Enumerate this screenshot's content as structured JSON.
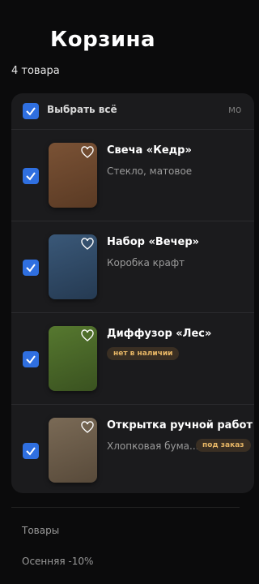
{
  "page": {
    "title": "Корзина",
    "count": "4 товара"
  },
  "select_all": {
    "label": "Выбрать всё",
    "more": "мо"
  },
  "items": [
    {
      "name": "Свеча «Кедр»",
      "subtitle": "Стекло, матовое",
      "badge": "",
      "color": "#6f4a2f"
    },
    {
      "name": "Набор «Вечер»",
      "subtitle": "Коробка крафт",
      "badge": "",
      "color": "#2f4a66"
    },
    {
      "name": "Диффузор «Лес»",
      "subtitle": "",
      "badge": "нет в наличии",
      "color": "#4a6a2c"
    },
    {
      "name": "Открытка ручной работ",
      "subtitle": "Хлопковая бума...",
      "badge": "под заказ",
      "color": "#6e6050"
    }
  ],
  "summary": {
    "goods": "Товары",
    "discount": "Осенняя -10%"
  },
  "colors": {
    "accent": "#2f6fe0",
    "badge_text": "#e8b766"
  }
}
